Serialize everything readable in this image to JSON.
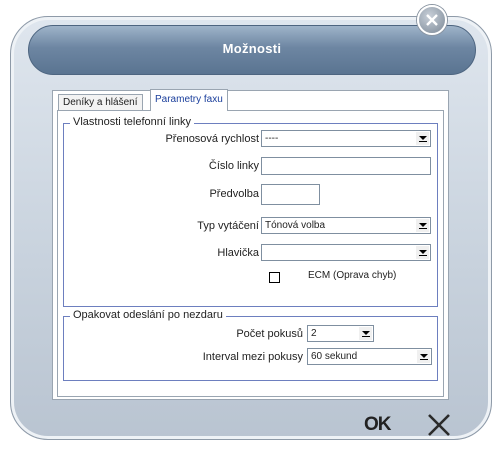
{
  "window": {
    "title": "Možnosti"
  },
  "tabs": [
    {
      "label": "Deníky a hlášení",
      "active": false
    },
    {
      "label": "Parametry faxu",
      "active": true
    }
  ],
  "line_group": {
    "legend": "Vlastnosti telefonní linky",
    "speed": {
      "label": "Přenosová rychlost",
      "value": "----"
    },
    "line_number": {
      "label": "Číslo linky",
      "value": ""
    },
    "prefix": {
      "label": "Předvolba",
      "value": ""
    },
    "dial_type": {
      "label": "Typ vytáčení",
      "value": "Tónová volba"
    },
    "header": {
      "label": "Hlavička",
      "value": ""
    },
    "ecm": {
      "label": "ECM (Oprava chyb)",
      "checked": false
    }
  },
  "retry_group": {
    "legend": "Opakovat odeslání po nezdaru",
    "attempts": {
      "label": "Počet pokusů",
      "value": "2"
    },
    "interval": {
      "label": "Interval mezi pokusy",
      "value": "60 sekund"
    }
  },
  "buttons": {
    "ok": "OK",
    "cancel_icon": "close-x-icon",
    "close_icon": "close-circle-icon"
  },
  "colors": {
    "active_tab_text": "#1b3f9c",
    "group_border": "#6d7fbf",
    "titlebar": "#6d86a2"
  }
}
